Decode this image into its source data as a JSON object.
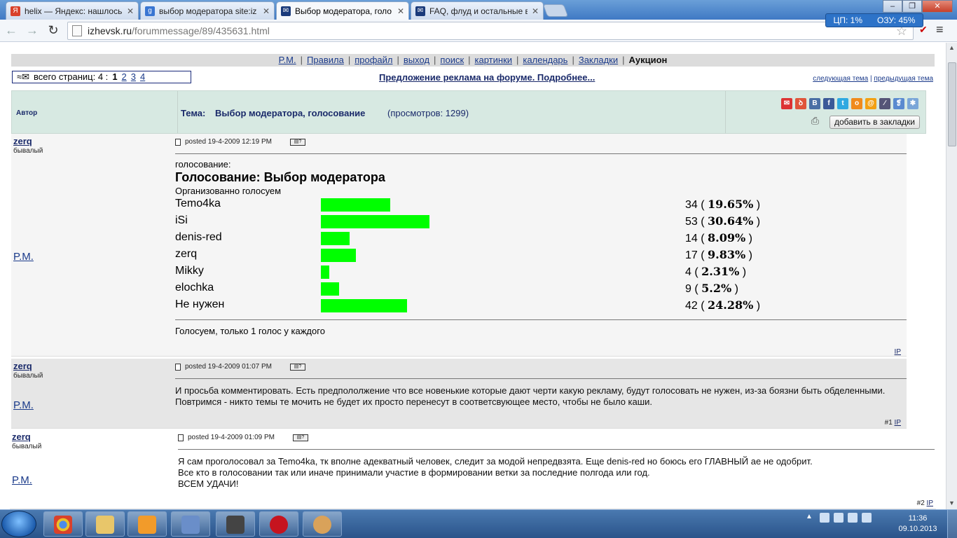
{
  "browser": {
    "tabs": [
      {
        "title": "helix — Яндекс: нашлось",
        "fav_text": "Я",
        "fav_color": "#d9412a",
        "active": false
      },
      {
        "title": "выбор модератора site:iz",
        "fav_text": "g",
        "fav_color": "#3a76d2",
        "active": false
      },
      {
        "title": "Выбор модератора, голо",
        "fav_text": "✉",
        "fav_color": "#1a3a7a",
        "active": true
      },
      {
        "title": "FAQ, флуд и остальные в",
        "fav_text": "✉",
        "fav_color": "#1a3a7a",
        "active": false
      }
    ],
    "url_host": "izhevsk.ru",
    "url_path": "/forummessage/89/435631.html",
    "cpu_label": "ЦП: 1%",
    "ram_label": "ОЗУ: 45%"
  },
  "nav": {
    "links": [
      "P.M.",
      "Правила",
      "профайл",
      "выход",
      "поиск",
      "картинки",
      "календарь",
      "Закладки"
    ],
    "bold_link": "Аукцион",
    "sep": "|"
  },
  "pager": {
    "label": "всего страниц: 4 :",
    "pages": [
      "1",
      "2",
      "3",
      "4"
    ],
    "current": "1"
  },
  "ad_link": "Предложение реклама на форуме. Подробнее...",
  "topic_links": {
    "next": "следующая тема",
    "prev": "предыдущая тема",
    "sep": "|"
  },
  "header": {
    "author_col": "Автор",
    "topic_label": "Тема:",
    "topic_title": "Выбор модератора, голосование",
    "views": "(просмотров: 1299)",
    "bookmark_button": "добавить в закладки"
  },
  "posts": [
    {
      "author": "zerq",
      "rank": "бывалый",
      "pm": "P.M.",
      "posted": "posted 19-4-2009 12:19 PM",
      "ip": "IP",
      "num": ""
    },
    {
      "author": "zerq",
      "rank": "бывалый",
      "pm": "P.M.",
      "posted": "posted 19-4-2009 01:07 PM",
      "body": "И просьба комментировать. Есть предпололжение что все новенькие которые дают черти какую рекламу, будут голосовать не нужен, из-за боязни быть обделенными. Повтримся - никто темы те мочить не будет их просто перенесут в соответсвующее место, чтобы не было каши.",
      "ip": "IP",
      "num": "#1"
    },
    {
      "author": "zerq",
      "rank": "бывалый",
      "pm": "P.M.",
      "posted": "posted 19-4-2009 01:09 PM",
      "body_lines": [
        "Я сам проголосовал за Temo4ka, тк вполне адекватный человек, следит за модой непредвзята. Еще denis-red но боюсь его ГЛАВНЫЙ ае не одобрит.",
        "Все кто в голосовании так или иначе принимали участие в формировании ветки за последние полгода или год.",
        "ВСЕМ УДАЧИ!"
      ],
      "ip": "IP",
      "num": "#2"
    }
  ],
  "poll": {
    "label": "голосование:",
    "title": "Голосование: Выбор модератора",
    "organizer": "Организованно голосуем",
    "footer": "Голосуем, только 1 голос у каждого",
    "bar_color": "#00ff00"
  },
  "chart_data": {
    "type": "bar",
    "categories": [
      "Temo4ka",
      "iSi",
      "denis-red",
      "zerq",
      "Mikky",
      "elochka",
      "Не нужен"
    ],
    "values": [
      34,
      53,
      14,
      17,
      4,
      9,
      42
    ],
    "percents": [
      "19.65%",
      "30.64%",
      "8.09%",
      "9.83%",
      "2.31%",
      "5.2%",
      "24.28%"
    ],
    "title": "Голосование: Выбор модератора"
  },
  "taskbar": {
    "time": "11:36",
    "date": "09.10.2013"
  }
}
